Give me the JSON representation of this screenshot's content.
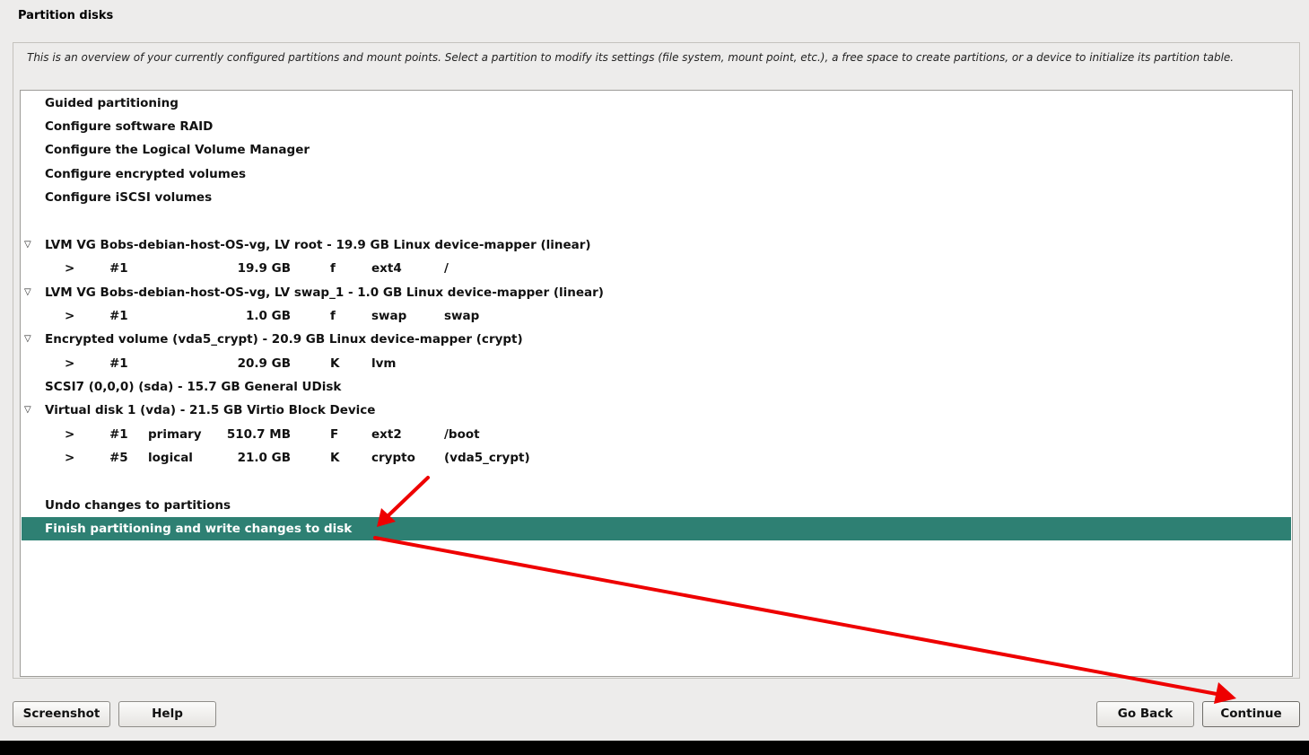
{
  "header": {
    "title": "Partition disks"
  },
  "description": "This is an overview of your currently configured partitions and mount points. Select a partition to modify its settings (file system, mount point, etc.), a free space to create partitions, or a device to initialize its partition table.",
  "menu": {
    "guided": "Guided partitioning",
    "raid": "Configure software RAID",
    "lvm": "Configure the Logical Volume Manager",
    "encrypted": "Configure encrypted volumes",
    "iscsi": "Configure iSCSI volumes"
  },
  "devices": {
    "lvm_root": {
      "label": "LVM VG Bobs-debian-host-OS-vg, LV root - 19.9 GB Linux device-mapper (linear)",
      "partition": {
        "arrow": ">",
        "num": "#1",
        "type": "",
        "size": "19.9 GB",
        "flag": "f",
        "fs": "ext4",
        "mount": "/"
      }
    },
    "lvm_swap": {
      "label": "LVM VG Bobs-debian-host-OS-vg, LV swap_1 - 1.0 GB Linux device-mapper (linear)",
      "partition": {
        "arrow": ">",
        "num": "#1",
        "type": "",
        "size": "1.0 GB",
        "flag": "f",
        "fs": "swap",
        "mount": "swap"
      }
    },
    "crypt": {
      "label": "Encrypted volume (vda5_crypt) - 20.9 GB Linux device-mapper (crypt)",
      "partition": {
        "arrow": ">",
        "num": "#1",
        "type": "",
        "size": "20.9 GB",
        "flag": "K",
        "fs": "lvm",
        "mount": ""
      }
    },
    "sda": {
      "label": "SCSI7 (0,0,0) (sda) - 15.7 GB General UDisk"
    },
    "vda": {
      "label": "Virtual disk 1 (vda) - 21.5 GB Virtio Block Device",
      "partitions": [
        {
          "arrow": ">",
          "num": "#1",
          "type": "primary",
          "size": "510.7 MB",
          "flag": "F",
          "fs": "ext2",
          "mount": "/boot"
        },
        {
          "arrow": ">",
          "num": "#5",
          "type": "logical",
          "size": "21.0 GB",
          "flag": "K",
          "fs": "crypto",
          "mount": "(vda5_crypt)"
        }
      ]
    }
  },
  "actions": {
    "undo": "Undo changes to partitions",
    "finish": "Finish partitioning and write changes to disk"
  },
  "expander_glyph": "▽",
  "buttons": {
    "screenshot": "Screenshot",
    "help": "Help",
    "go_back": "Go Back",
    "continue": "Continue"
  },
  "colors": {
    "selection": "#2e8073",
    "annotation_arrow": "#ee0000"
  }
}
